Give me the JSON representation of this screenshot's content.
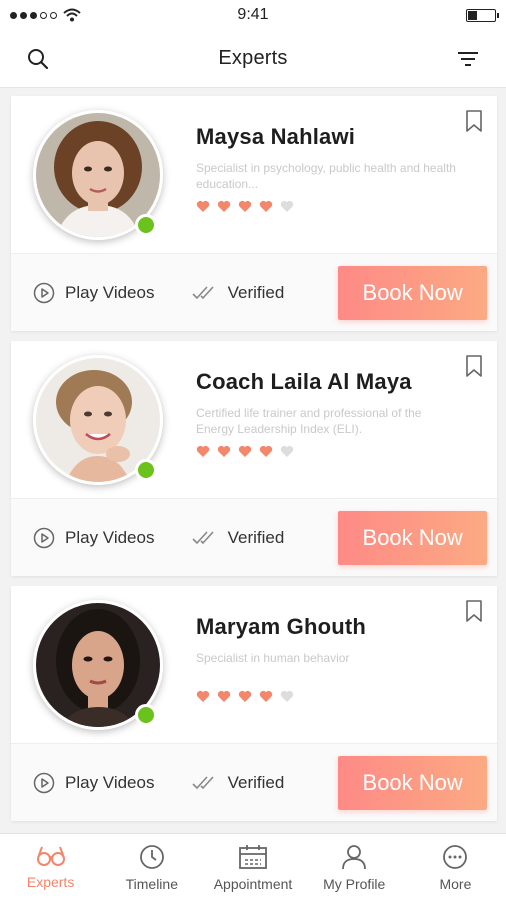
{
  "status_bar": {
    "time": "9:41",
    "signal_icon": "signal-dots-icon",
    "wifi_icon": "wifi-icon",
    "battery_icon": "battery-icon"
  },
  "header": {
    "title": "Experts",
    "search_icon": "search-icon",
    "filter_icon": "filter-icon"
  },
  "colors": {
    "accent": "#f5846a",
    "button_start": "#fd8a86",
    "button_end": "#fcaa83",
    "online": "#6cc21c",
    "star_filled": "#f2876b",
    "star_empty": "#dddddd"
  },
  "experts": [
    {
      "name": "Maysa Nahlawi",
      "description": "Specialist in psychology, public health and health education...",
      "rating": 4,
      "rating_max": 5,
      "online": true,
      "play_label": "Play Videos",
      "verified_label": "Verified",
      "book_label": "Book Now"
    },
    {
      "name": "Coach Laila Al Maya",
      "description": "Certified life trainer and professional of the Energy Leadership Index (ELI).",
      "rating": 4,
      "rating_max": 5,
      "online": true,
      "play_label": "Play Videos",
      "verified_label": "Verified",
      "book_label": "Book Now"
    },
    {
      "name": "Maryam Ghouth",
      "description": "Specialist in human behavior",
      "rating": 4,
      "rating_max": 5,
      "online": true,
      "play_label": "Play Videos",
      "verified_label": "Verified",
      "book_label": "Book Now"
    }
  ],
  "tabs": [
    {
      "label": "Experts",
      "icon": "glasses-icon",
      "active": true
    },
    {
      "label": "Timeline",
      "icon": "clock-icon",
      "active": false
    },
    {
      "label": "Appointment",
      "icon": "calendar-icon",
      "active": false
    },
    {
      "label": "My Profile",
      "icon": "user-icon",
      "active": false
    },
    {
      "label": "More",
      "icon": "more-icon",
      "active": false
    }
  ]
}
